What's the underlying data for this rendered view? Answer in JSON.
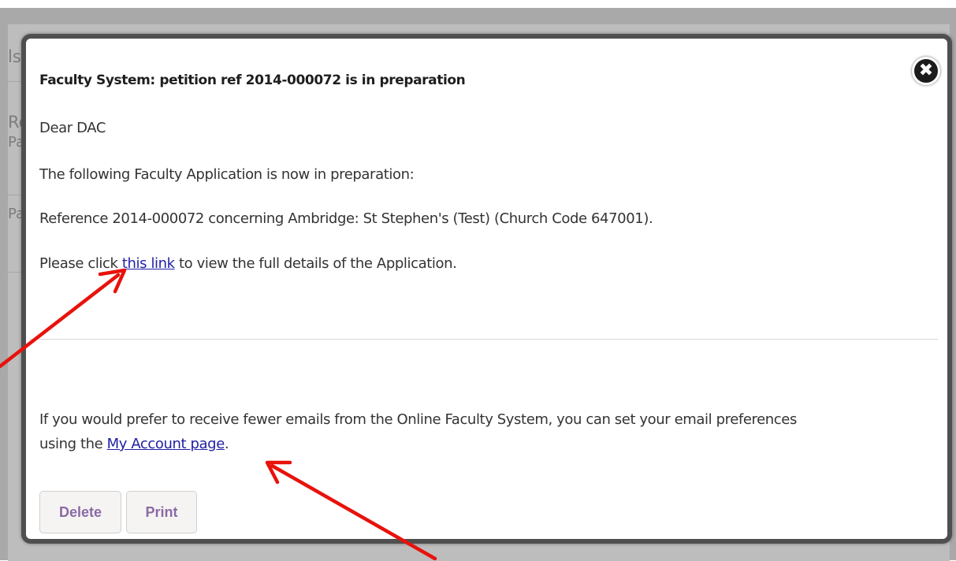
{
  "background": {
    "fragments": [
      "ls",
      "Re",
      "Pa",
      "Pa"
    ]
  },
  "modal": {
    "close_icon_glyph": "✖",
    "subject": "Faculty System: petition ref 2014-000072 is in preparation",
    "greeting": "Dear DAC",
    "intro": "The following Faculty Application is now in preparation:",
    "reference": "Reference 2014-000072 concerning Ambridge: St Stephen's (Test) (Church Code 647001).",
    "click_prefix": "Please click ",
    "click_link": "this link",
    "click_suffix": " to view the full details of the Application.",
    "prefs_line1": "If you would prefer to receive fewer emails from the Online Faculty System, you can set your email preferences",
    "prefs_prefix": "using the ",
    "prefs_link": "My Account page",
    "prefs_suffix": ".",
    "buttons": {
      "delete": "Delete",
      "print": "Print"
    }
  },
  "annotations": {
    "arrow_color": "#e8120c"
  }
}
